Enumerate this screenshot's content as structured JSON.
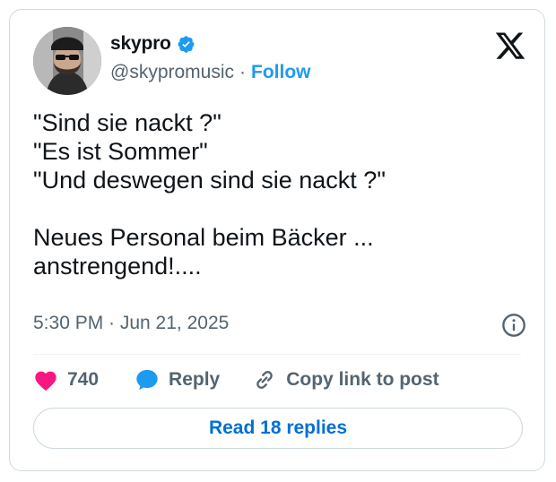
{
  "author": {
    "display_name": "skypro",
    "handle": "@skypromusic",
    "separator": "·",
    "follow_label": "Follow",
    "verified_color": "#1d9bf0"
  },
  "tweet": {
    "text": "\"Sind sie nackt ?\"\n\"Es ist Sommer\"\n\"Und deswegen sind sie nackt ?\"\n\nNeues Personal beim Bäcker ...\nanstrengend!....",
    "timestamp": "5:30 PM · Jun 21, 2025"
  },
  "actions": {
    "like_count": "740",
    "reply_label": "Reply",
    "copy_link_label": "Copy link to post"
  },
  "read_replies_label": "Read 18 replies",
  "icons": [
    "avatar",
    "verified-badge-icon",
    "x-logo-icon",
    "info-icon",
    "heart-icon",
    "reply-bubble-icon",
    "link-icon"
  ],
  "colors": {
    "accent": "#1d9bf0",
    "heart": "#f91880",
    "muted": "#536471"
  }
}
